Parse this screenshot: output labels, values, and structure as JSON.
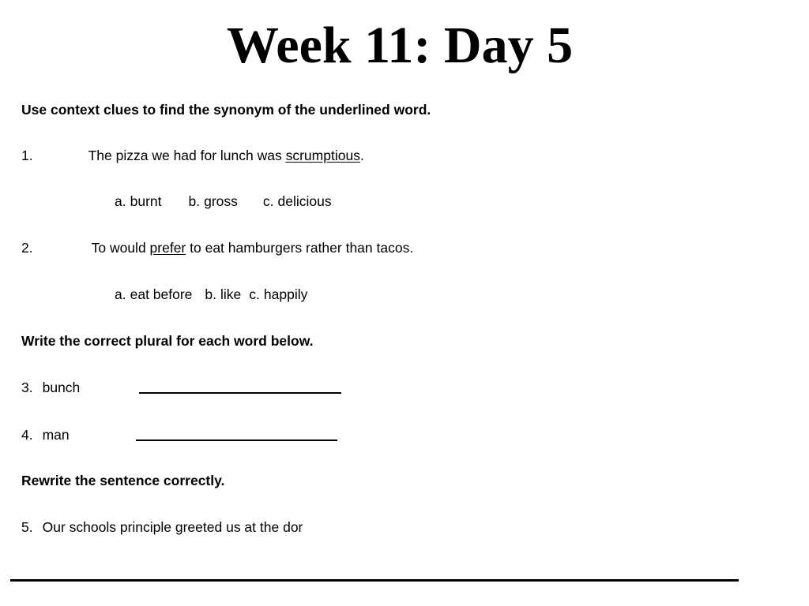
{
  "worksheet": {
    "title": "Week 11: Day 5",
    "sections": [
      {
        "instruction": "Use context clues to find the synonym of the underlined word.",
        "items": [
          {
            "number": "1.",
            "text_before": "The pizza we had for lunch was ",
            "underlined_word": "scrumptious",
            "text_after": ".",
            "choices": [
              {
                "letter": "a.",
                "label": "burnt"
              },
              {
                "letter": "b.",
                "label": "gross"
              },
              {
                "letter": "c.",
                "label": "delicious"
              }
            ]
          },
          {
            "number": "2.",
            "text_before": "To would ",
            "underlined_word": "prefer",
            "text_after": " to eat hamburgers rather than tacos.",
            "choices": [
              {
                "letter": "a.",
                "label": "eat before"
              },
              {
                "letter": "b.",
                "label": "like"
              },
              {
                "letter": "c.",
                "label": "happily"
              }
            ]
          }
        ]
      },
      {
        "instruction": "Write the correct plural for each word below.",
        "items": [
          {
            "number": "3.",
            "word": "bunch",
            "answer": ""
          },
          {
            "number": "4.",
            "word": "man",
            "answer": ""
          }
        ]
      },
      {
        "instruction": "Rewrite the sentence correctly.",
        "items": [
          {
            "number": "5.",
            "sentence": "Our schools principle greeted us at the dor",
            "answer": ""
          }
        ]
      }
    ]
  }
}
